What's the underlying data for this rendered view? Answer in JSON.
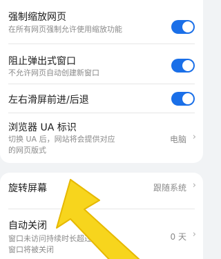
{
  "settings": {
    "force_zoom": {
      "title": "强制缩放网页",
      "desc": "在所有网页强制允许使用缩放功能",
      "enabled": true
    },
    "block_popups": {
      "title": "阻止弹出式窗口",
      "desc": "不允许网页自动创建新窗口",
      "enabled": true
    },
    "swipe_nav": {
      "title": "左右滑屏前进/后退",
      "enabled": true
    },
    "ua": {
      "title": "浏览器 UA 标识",
      "desc_line1": "切换 UA 后，网站将会提供对应",
      "desc_line2": "的网页版式",
      "value": "电脑"
    },
    "rotate": {
      "title": "旋转屏幕",
      "value": "跟随系统"
    },
    "auto_close": {
      "title": "自动关闭",
      "desc_line1": "窗口未访问持续时长超过设定",
      "desc_line2": "窗口将被关闭",
      "value": "0 天"
    }
  },
  "colors": {
    "toggle_on": "#1a6fe8",
    "arrow": "#f7d51d"
  }
}
